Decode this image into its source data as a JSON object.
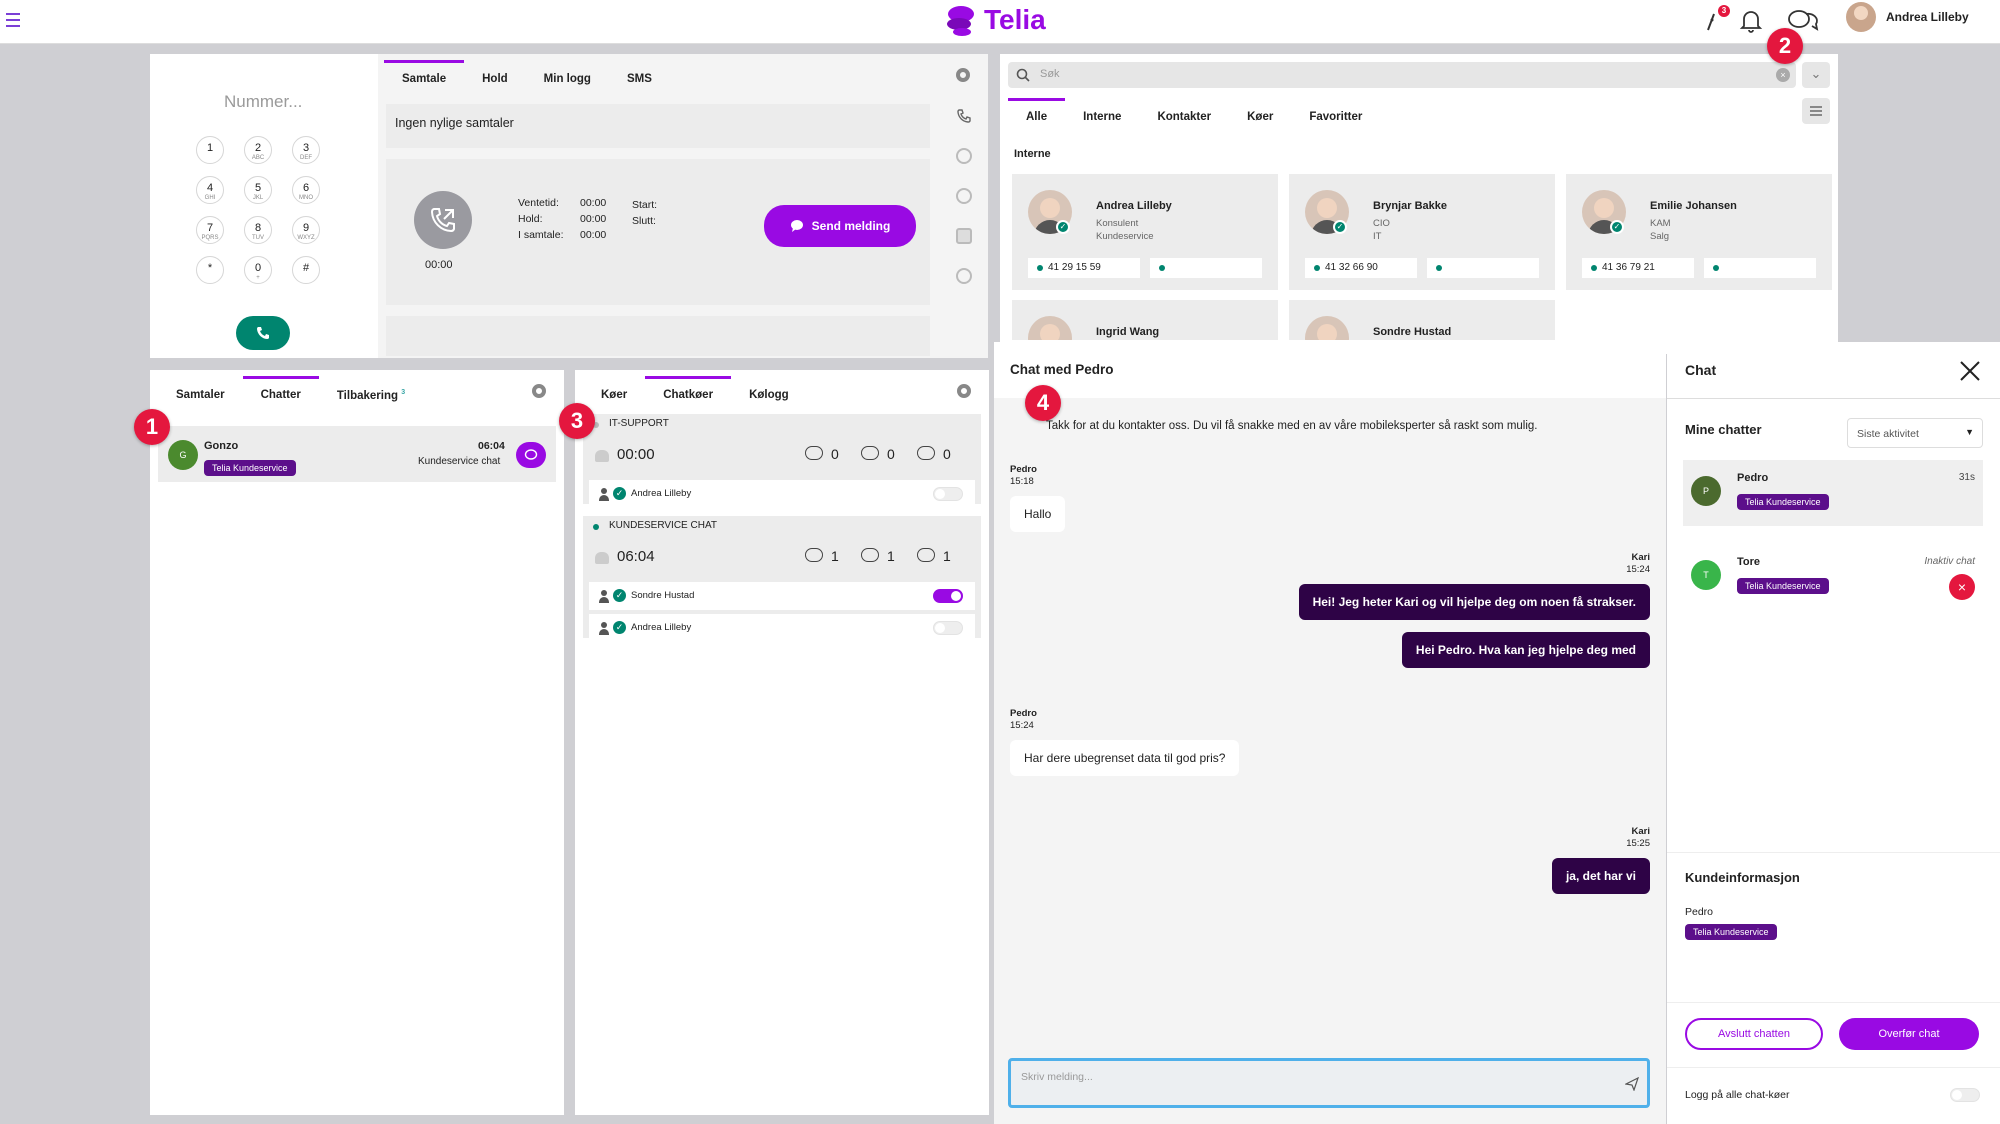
{
  "topbar": {
    "brand": "Telia",
    "notif_count": "3",
    "user_name": "Andrea Lilleby"
  },
  "callouts": [
    "1",
    "2",
    "3",
    "4"
  ],
  "dialer": {
    "placeholder": "Nummer...",
    "keys": [
      {
        "digit": "1",
        "letters": ""
      },
      {
        "digit": "2",
        "letters": "ABC"
      },
      {
        "digit": "3",
        "letters": "DEF"
      },
      {
        "digit": "4",
        "letters": "GHI"
      },
      {
        "digit": "5",
        "letters": "JKL"
      },
      {
        "digit": "6",
        "letters": "MNO"
      },
      {
        "digit": "7",
        "letters": "PQRS"
      },
      {
        "digit": "8",
        "letters": "TUV"
      },
      {
        "digit": "9",
        "letters": "WXYZ"
      },
      {
        "digit": "*",
        "letters": ""
      },
      {
        "digit": "0",
        "letters": "+"
      },
      {
        "digit": "#",
        "letters": ""
      }
    ]
  },
  "call": {
    "tabs": [
      "Samtale",
      "Hold",
      "Min logg",
      "SMS"
    ],
    "no_recent": "Ingen nylige samtaler",
    "timer": "00:00",
    "ventetid_label": "Ventetid:",
    "ventetid": "00:00",
    "hold_label": "Hold:",
    "hold": "00:00",
    "isamtale_label": "I samtale:",
    "isamtale": "00:00",
    "start_label": "Start:",
    "slutt_label": "Slutt:",
    "send_button": "Send melding"
  },
  "directory": {
    "search_placeholder": "Søk",
    "tabs": [
      "Alle",
      "Interne",
      "Kontakter",
      "Køer",
      "Favoritter"
    ],
    "section": "Interne",
    "contacts": [
      {
        "name": "Andrea Lilleby",
        "title": "Konsulent",
        "dept": "Kundeservice",
        "phone": "41 29 15 59"
      },
      {
        "name": "Brynjar Bakke",
        "title": "CIO",
        "dept": "IT",
        "phone": "41 32 66 90"
      },
      {
        "name": "Emilie Johansen",
        "title": "KAM",
        "dept": "Salg",
        "phone": "41 36 79 21"
      },
      {
        "name": "Ingrid Wang"
      },
      {
        "name": "Sondre Hustad"
      }
    ]
  },
  "chats_panel": {
    "tabs": [
      "Samtaler",
      "Chatter",
      "Tilbakering"
    ],
    "tilbakering_count": "3",
    "item": {
      "initial": "G",
      "name": "Gonzo",
      "time": "06:04",
      "queue": "Kundeservice chat",
      "tag": "Telia Kundeservice"
    }
  },
  "queues_panel": {
    "tabs": [
      "Køer",
      "Chatkøer",
      "Kølogg"
    ],
    "queues": [
      {
        "name": "IT-SUPPORT",
        "time": "00:00",
        "chats": "0",
        "agents": "0",
        "waiting": "0",
        "members": [
          {
            "name": "Andrea Lilleby",
            "on": false
          }
        ]
      },
      {
        "name": "KUNDESERVICE CHAT",
        "time": "06:04",
        "chats": "1",
        "agents": "1",
        "waiting": "1",
        "members": [
          {
            "name": "Sondre Hustad",
            "on": true
          },
          {
            "name": "Andrea Lilleby",
            "on": false
          }
        ]
      }
    ]
  },
  "conversation": {
    "title": "Chat med Pedro",
    "intro": "Takk for at du kontakter oss. Du vil få snakke med en av våre mobileksperter så raskt som mulig.",
    "messages": [
      {
        "from": "Pedro",
        "time": "15:18",
        "text": "Hallo",
        "dir": "in"
      },
      {
        "from": "Kari",
        "time": "15:24",
        "text": "Hei! Jeg heter Kari og vil hjelpe deg om noen få strakser.",
        "dir": "out"
      },
      {
        "from": "",
        "time": "",
        "text": "Hei Pedro. Hva kan jeg hjelpe deg med",
        "dir": "out"
      },
      {
        "from": "Pedro",
        "time": "15:24",
        "text": "Har dere ubegrenset data til god pris?",
        "dir": "in"
      },
      {
        "from": "Kari",
        "time": "15:25",
        "text": "ja, det har vi",
        "dir": "out"
      }
    ],
    "input_placeholder": "Skriv melding..."
  },
  "chat_side": {
    "title": "Chat",
    "mine_label": "Mine chatter",
    "sort": "Siste aktivitet",
    "chats": [
      {
        "initial": "P",
        "name": "Pedro",
        "status": "31s",
        "tag": "Telia Kundeservice",
        "color": "#4b6a2e"
      },
      {
        "initial": "T",
        "name": "Tore",
        "status": "Inaktiv chat",
        "tag": "Telia Kundeservice",
        "color": "#39b54a"
      }
    ],
    "info_title": "Kundeinformasjon",
    "info_name": "Pedro",
    "info_tag": "Telia Kundeservice",
    "end_button": "Avslutt chatten",
    "transfer_button": "Overfør chat",
    "login_all": "Logg på alle chat-køer"
  }
}
